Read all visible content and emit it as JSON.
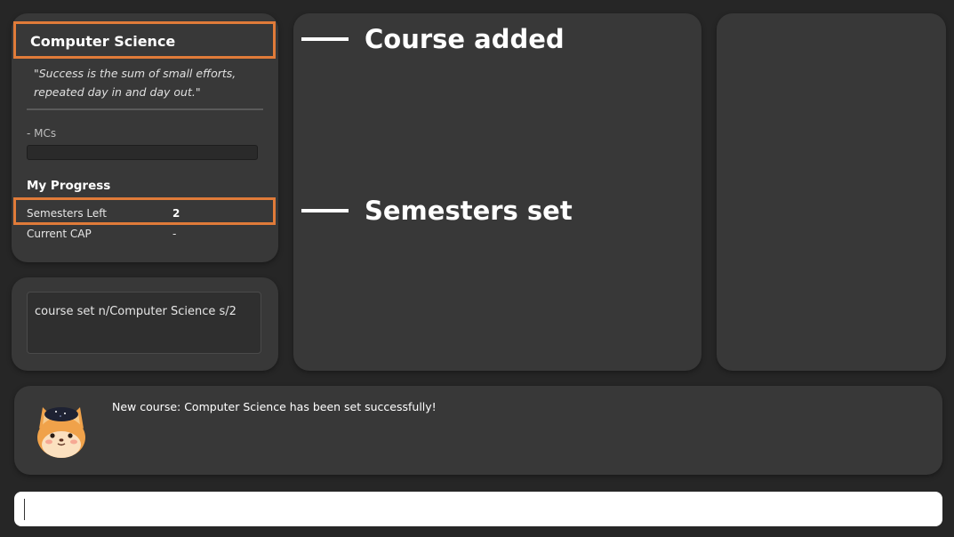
{
  "course_panel": {
    "course_name": "Computer Science",
    "quote": "\"Success is the sum of small efforts, repeated day in and day out.\"",
    "mcs_label": "- MCs",
    "mcs_progress": 0,
    "progress_heading": "My Progress",
    "semesters_left_label": "Semesters Left",
    "semesters_left_value": "2",
    "current_cap_label": "Current CAP",
    "current_cap_value": "-"
  },
  "command_box": {
    "text": "course set n/Computer Science s/2"
  },
  "result_panel": {
    "message": "New course: Computer Science has been set successfully!",
    "avatar": "cat-mascot-icon"
  },
  "command_input": {
    "value": ""
  },
  "annotations": {
    "course_added": "Course added",
    "semesters_set": "Semesters set",
    "highlight_color": "#e07b39"
  }
}
